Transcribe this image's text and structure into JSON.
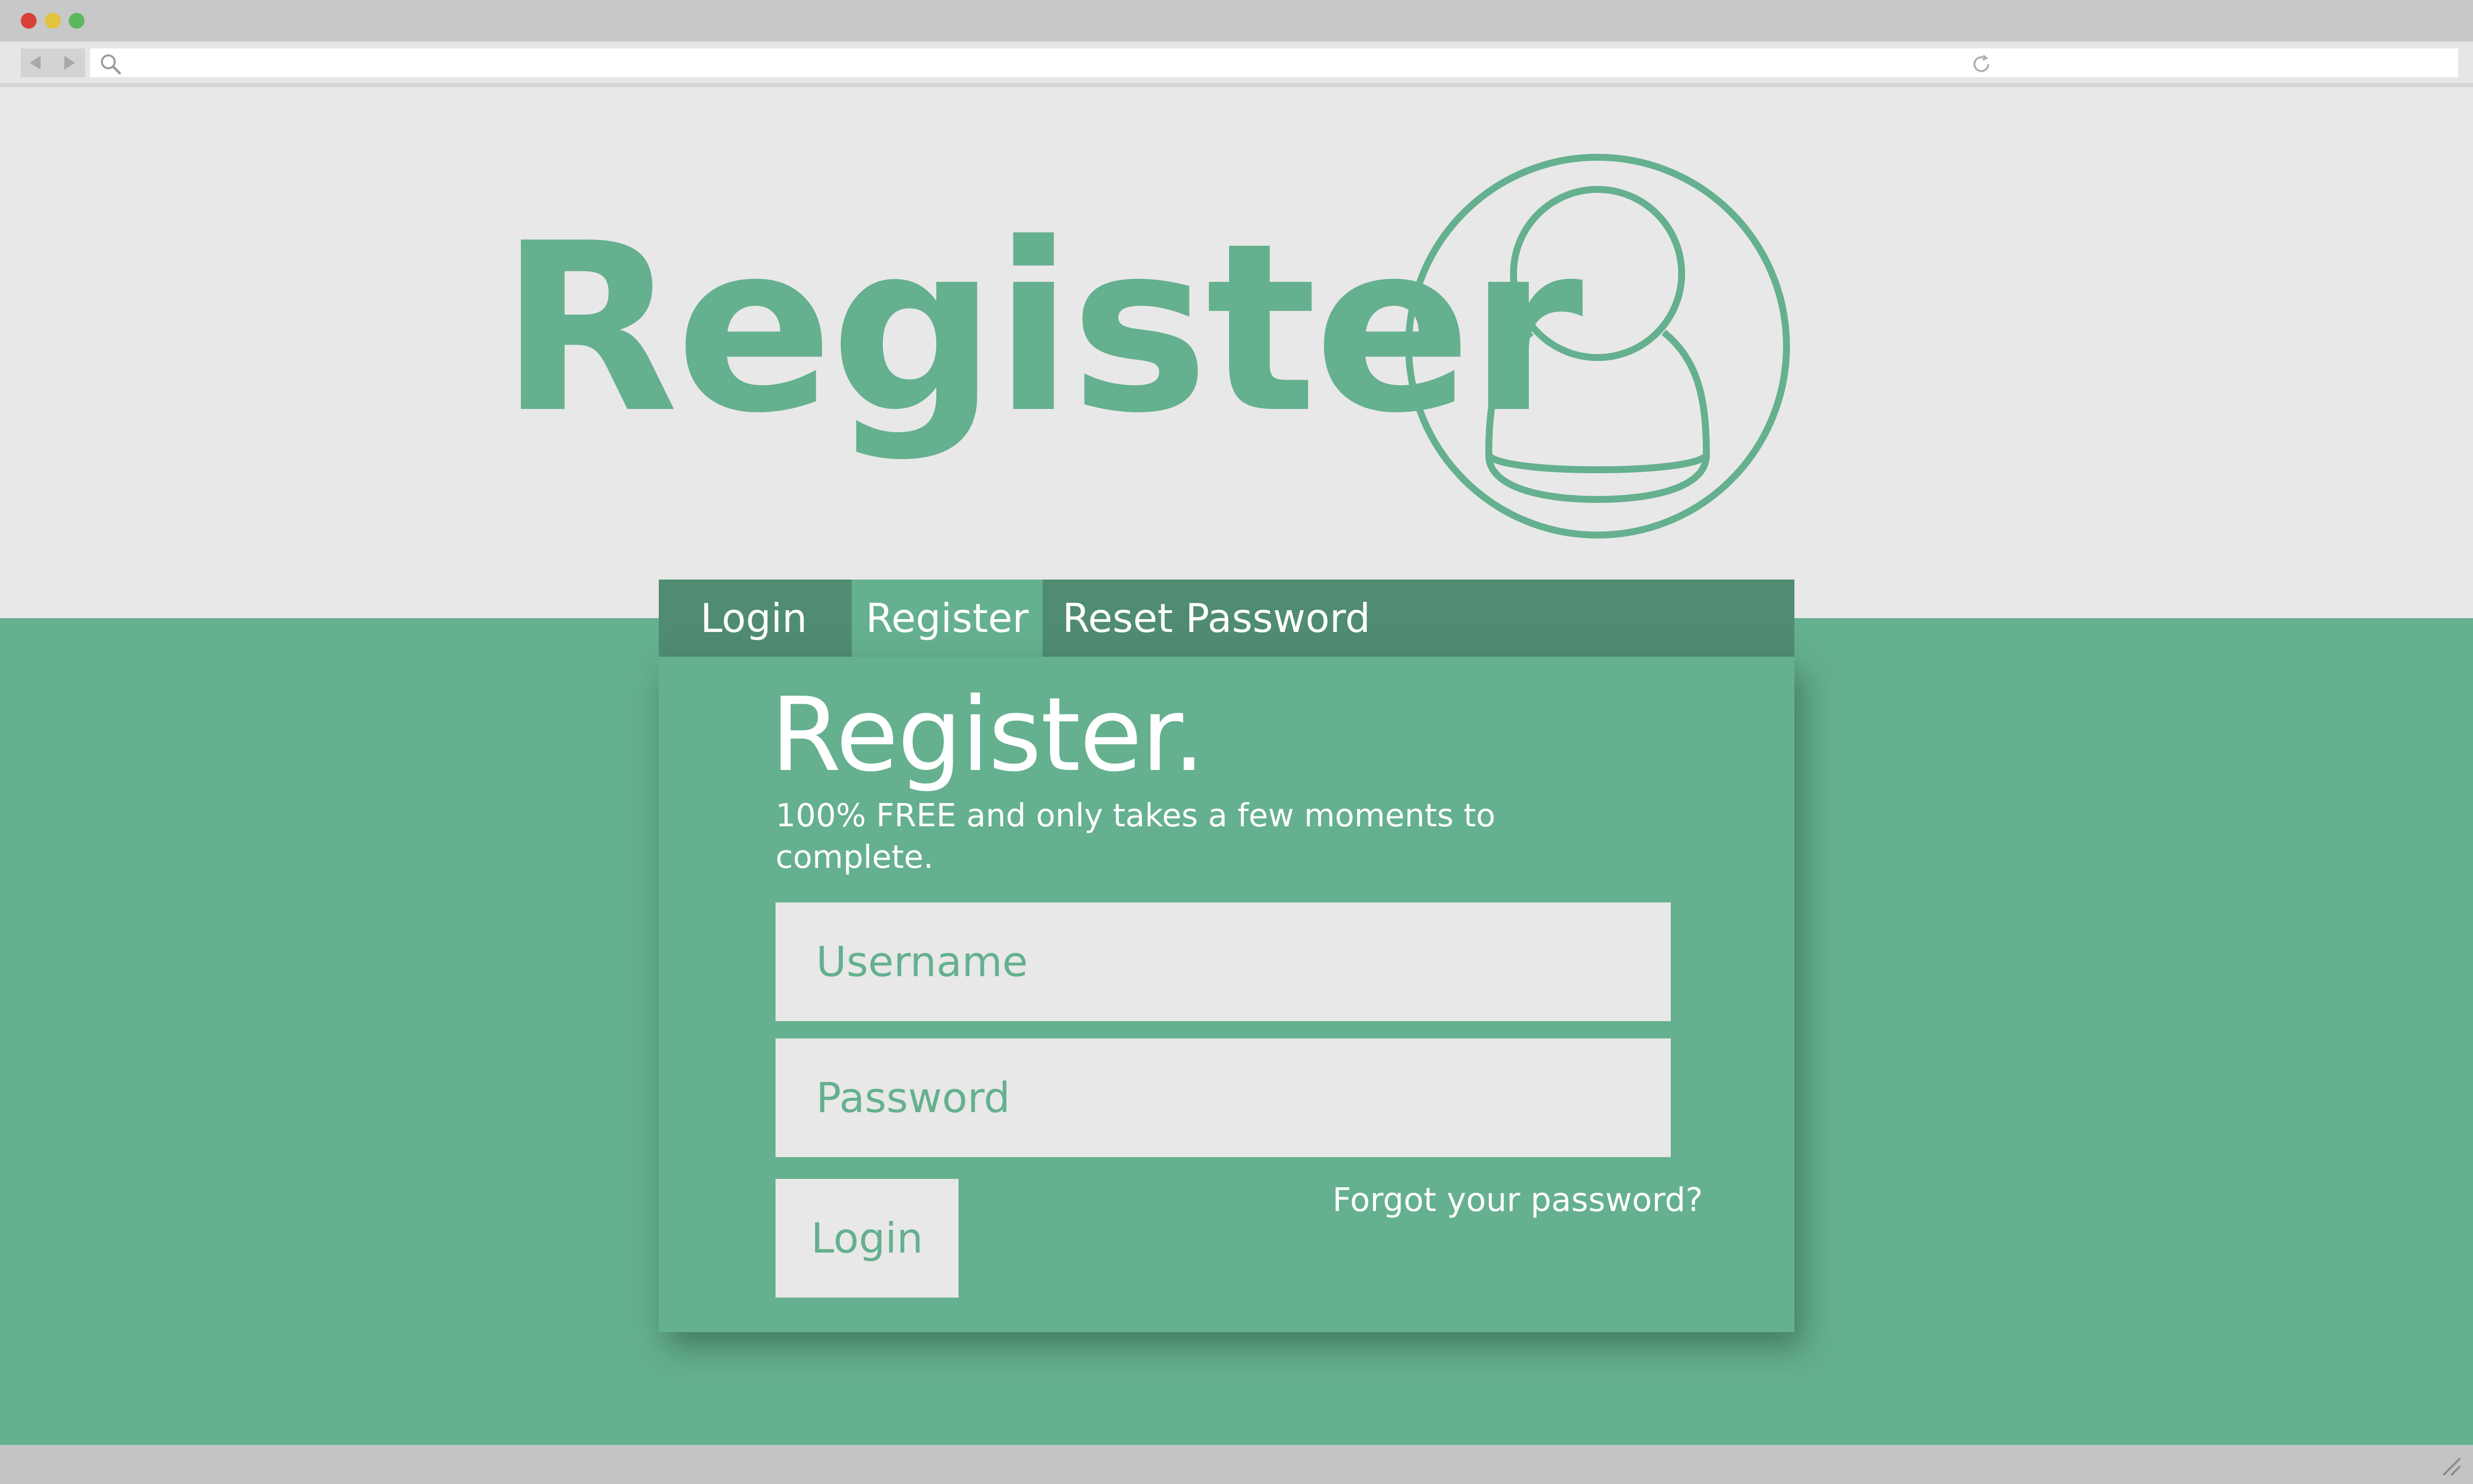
{
  "colors": {
    "accent": "#65b08f",
    "accent_dark": "#4f8c72",
    "page_background": "#e8e8e8",
    "chrome": "#c8c8c8",
    "white": "#ffffff"
  },
  "browser": {
    "traffic_lights": [
      "close",
      "minimize",
      "maximize"
    ],
    "icons": {
      "back": "chevron-left-icon",
      "forward": "chevron-right-icon",
      "search": "search-icon",
      "reload": "reload-icon",
      "resize": "resize-grip-icon"
    }
  },
  "hero": {
    "title": "Register",
    "icon": "user-avatar-icon"
  },
  "tabs": [
    {
      "label": "Login",
      "active": false
    },
    {
      "label": "Register",
      "active": true
    },
    {
      "label": "Reset Password",
      "active": false
    }
  ],
  "form": {
    "title": "Register.",
    "subtitle": "100% FREE and only takes a few moments to complete.",
    "username_placeholder": "Username",
    "password_placeholder": "Password",
    "submit_label": "Login",
    "forgot_link": "Forgot your password?"
  }
}
